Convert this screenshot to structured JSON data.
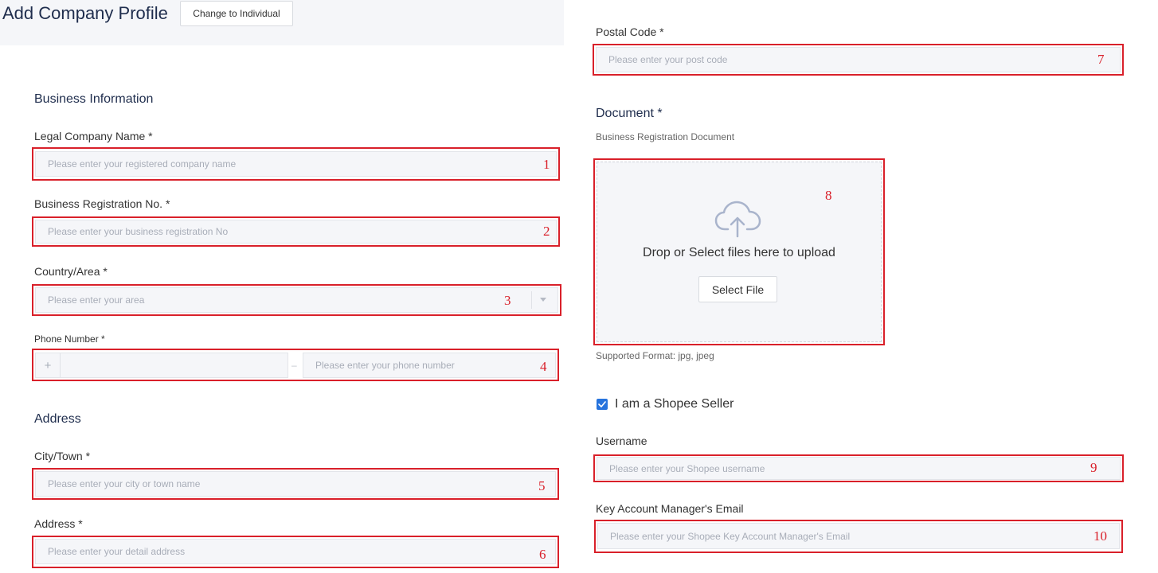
{
  "header": {
    "title": "Add Company Profile",
    "change_button": "Change to Individual"
  },
  "business_info": {
    "section_title": "Business Information",
    "company_name": {
      "label": "Legal Company Name *",
      "placeholder": "Please enter your registered company name",
      "marker": "1"
    },
    "registration_no": {
      "label": "Business Registration No. *",
      "placeholder": "Please enter your business registration No",
      "marker": "2"
    },
    "country": {
      "label": "Country/Area *",
      "placeholder": "Please enter your area",
      "marker": "3",
      "dropdown_icon": "caret-down-icon"
    },
    "phone": {
      "label": "Phone Number *",
      "prefix_symbol": "+",
      "separator": "–",
      "placeholder": "Please enter your phone number",
      "marker": "4"
    }
  },
  "address": {
    "section_title": "Address",
    "city": {
      "label": "City/Town *",
      "placeholder": "Please enter your city or town name",
      "marker": "5"
    },
    "detail": {
      "label": "Address *",
      "placeholder": "Please enter your detail address",
      "marker": "6"
    },
    "postal": {
      "label": "Postal Code *",
      "placeholder": "Please enter your post code",
      "marker": "7"
    }
  },
  "document": {
    "section_title": "Document *",
    "subtitle": "Business Registration Document",
    "marker": "8",
    "upload_icon": "cloud-upload-icon",
    "upload_text": "Drop or Select files here to upload",
    "select_button": "Select File",
    "supported": "Supported Format: jpg, jpeg"
  },
  "seller": {
    "checkbox_label": "I am a Shopee Seller",
    "checked": true,
    "username": {
      "label": "Username",
      "placeholder": "Please enter your Shopee username",
      "marker": "9"
    },
    "kam_email": {
      "label": "Key Account Manager's Email",
      "placeholder": "Please enter your Shopee Key Account Manager's Email",
      "marker": "10"
    }
  },
  "colors": {
    "annotation_red": "#d9202a",
    "checkbox_blue": "#2673dd",
    "title_navy": "#1f2d4d",
    "input_bg": "#f5f6f9"
  }
}
